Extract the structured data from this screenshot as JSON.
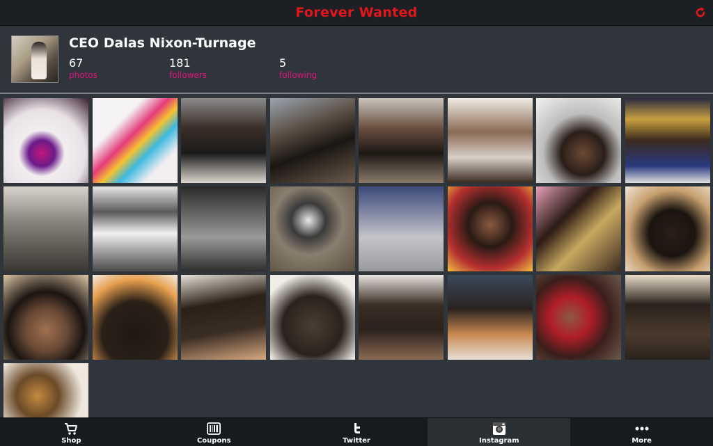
{
  "header": {
    "title": "Forever Wanted",
    "title_color": "#e3161c",
    "refresh_icon": "refresh-icon"
  },
  "profile": {
    "name": "CEO Dalas Nixon-Turnage",
    "stats": [
      {
        "value": "67",
        "label": "photos"
      },
      {
        "value": "181",
        "label": "followers"
      },
      {
        "value": "5",
        "label": "following"
      }
    ],
    "label_color": "#e0147d"
  },
  "photos": [
    {
      "desc": "Rainbow hair extension spelling 33 with rhinestone hat"
    },
    {
      "desc": "Rainbow wavy hair extension bundle"
    },
    {
      "desc": "Two women in black with hat at an expo"
    },
    {
      "desc": "Women posing at an expo hall"
    },
    {
      "desc": "Group of people at expo booth"
    },
    {
      "desc": "Man and two women at an event"
    },
    {
      "desc": "Selfie in a car"
    },
    {
      "desc": "Expo booth with banners"
    },
    {
      "desc": "Empty building hallway"
    },
    {
      "desc": "Unfinished ceiling with lights"
    },
    {
      "desc": "Trailer truck in parking lot"
    },
    {
      "desc": "Hair product bottle on lace"
    },
    {
      "desc": "Empty warehouse room"
    },
    {
      "desc": "Woman with short hairstyle"
    },
    {
      "desc": "Hairstyle collage"
    },
    {
      "desc": "Long weave hairstyle from behind"
    },
    {
      "desc": "Woman's face close-up under hair"
    },
    {
      "desc": "Top of head with hair"
    },
    {
      "desc": "Braids with weaving net"
    },
    {
      "desc": "Weaving net cap on braids"
    },
    {
      "desc": "Braids with clips"
    },
    {
      "desc": "Hair with clips at salon"
    },
    {
      "desc": "Woman with red curly hair"
    },
    {
      "desc": "Sew-in track close-up"
    },
    {
      "desc": "Cornrow braids pattern"
    }
  ],
  "nav": [
    {
      "label": "Shop",
      "icon": "cart-icon"
    },
    {
      "label": "Coupons",
      "icon": "coupon-icon"
    },
    {
      "label": "Twitter",
      "icon": "twitter-icon"
    },
    {
      "label": "Instagram",
      "icon": "instagram-icon",
      "active": true
    },
    {
      "label": "More",
      "icon": "more-icon"
    }
  ]
}
